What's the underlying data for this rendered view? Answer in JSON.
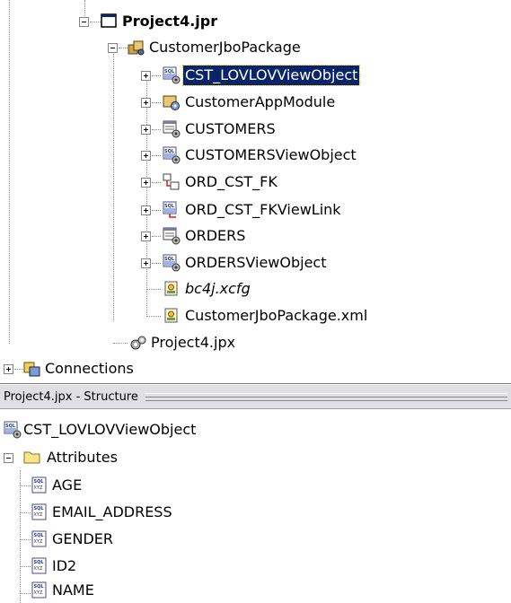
{
  "project_tree": {
    "project": {
      "label": "Project4.jpr"
    },
    "package": {
      "label": "CustomerJboPackage"
    },
    "items": [
      {
        "label": "CST_LOVLOVViewObject",
        "icon": "sql-view-object-icon",
        "selected": true
      },
      {
        "label": "CustomerAppModule",
        "icon": "app-module-icon"
      },
      {
        "label": "CUSTOMERS",
        "icon": "entity-object-icon"
      },
      {
        "label": "CUSTOMERSViewObject",
        "icon": "sql-view-object-icon"
      },
      {
        "label": "ORD_CST_FK",
        "icon": "association-icon"
      },
      {
        "label": "ORD_CST_FKViewLink",
        "icon": "view-link-icon"
      },
      {
        "label": "ORDERS",
        "icon": "entity-object-icon"
      },
      {
        "label": "ORDERSViewObject",
        "icon": "sql-view-object-icon"
      }
    ],
    "files": [
      {
        "label": "bc4j.xcfg",
        "icon": "config-file-icon"
      },
      {
        "label": "CustomerJboPackage.xml",
        "icon": "xml-file-icon"
      }
    ],
    "jpx": {
      "label": "Project4.jpx"
    },
    "connections": {
      "label": "Connections"
    }
  },
  "structure_panel": {
    "title": "Project4.jpx - Structure",
    "root": {
      "label": "CST_LOVLOVViewObject"
    },
    "folder": {
      "label": "Attributes"
    },
    "attributes": [
      "AGE",
      "EMAIL_ADDRESS",
      "GENDER",
      "ID2",
      "NAME"
    ]
  },
  "colors": {
    "selection": "#0a246a",
    "selection_text": "#ffffff",
    "header_bg": "#e0dfe3"
  }
}
